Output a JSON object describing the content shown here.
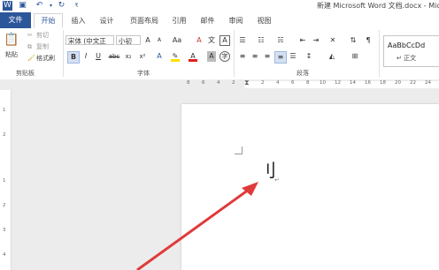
{
  "window": {
    "title": "新建 Microsoft Word 文档.docx - Micr"
  },
  "quick_access": [
    "word-icon",
    "save-icon",
    "undo-icon",
    "redo-icon",
    "customize-icon"
  ],
  "tabs": [
    "文件",
    "开始",
    "插入",
    "设计",
    "页面布局",
    "引用",
    "邮件",
    "审阅",
    "视图"
  ],
  "clipboard": {
    "paste": "粘贴",
    "cut": "剪切",
    "copy": "复制",
    "format_painter": "格式刷",
    "group": "剪贴板"
  },
  "font": {
    "name": "宋体 (中文正",
    "size": "小初",
    "group": "字体",
    "bold": "B",
    "italic": "I",
    "underline": "U",
    "strike": "abc",
    "sub": "x₂",
    "sup": "x²",
    "grow": "A",
    "shrink": "A",
    "case": "Aa",
    "clear": "A",
    "phonetic": "文",
    "border_char": "A"
  },
  "paragraph": {
    "group": "段落",
    "show_marks": "¶"
  },
  "styles": {
    "sample": "AaBbCcDd",
    "name": "↵ 正文"
  },
  "ruler": {
    "ticks": [
      "8",
      "6",
      "4",
      "2",
      "",
      "2",
      "4",
      "6",
      "8",
      "10",
      "12",
      "14",
      "16",
      "18",
      "20",
      "22",
      "24"
    ]
  },
  "vruler": {
    "ticks": [
      "1",
      "2",
      "1",
      "2",
      "3",
      "4"
    ]
  },
  "document": {
    "text": "刂",
    "mark": "↵"
  },
  "colors": {
    "accent": "#2b579a",
    "arrow": "#e03a3a"
  }
}
